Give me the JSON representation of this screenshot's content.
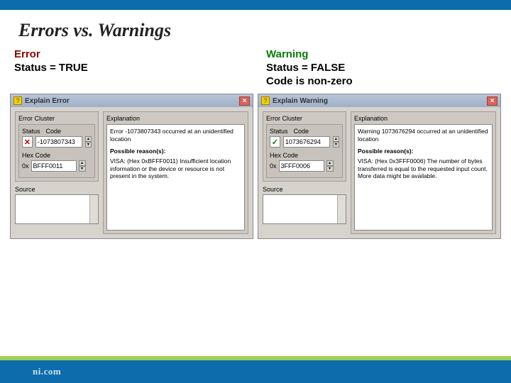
{
  "slide": {
    "title": "Errors vs. Warnings"
  },
  "left": {
    "head_color": "Error",
    "head_line2": "Status = TRUE",
    "dialog_title": "Explain Error",
    "cluster_label": "Error Cluster",
    "status_label": "Status",
    "code_label": "Code",
    "status_glyph": "✕",
    "code_value": "-1073807343",
    "hex_label": "Hex Code",
    "hex_prefix": "0x",
    "hex_value": "BFFF0011",
    "source_label": "Source",
    "expl_label": "Explanation",
    "expl_line1": "Error -1073807343 occurred at an unidentified location",
    "reasons_label": "Possible reason(s):",
    "expl_body": "VISA:  (Hex 0xBFFF0011) Insufficient location information or the device or resource is not present in the system."
  },
  "right": {
    "head_color": "Warning",
    "head_line2": "Status = FALSE",
    "head_line3": "Code is non-zero",
    "dialog_title": "Explain Warning",
    "cluster_label": "Error Cluster",
    "status_label": "Status",
    "code_label": "Code",
    "status_glyph": "✓",
    "code_value": "1073676294",
    "hex_label": "Hex Code",
    "hex_prefix": "0x",
    "hex_value": "3FFF0006",
    "source_label": "Source",
    "expl_label": "Explanation",
    "expl_line1": "Warning 1073676294 occurred at an unidentified location",
    "reasons_label": "Possible reason(s):",
    "expl_body": "VISA:  (Hex 0x3FFF0006) The number of bytes transferred is equal to the requested input count. More data might be available."
  },
  "footer": {
    "logo": "ni.com"
  }
}
